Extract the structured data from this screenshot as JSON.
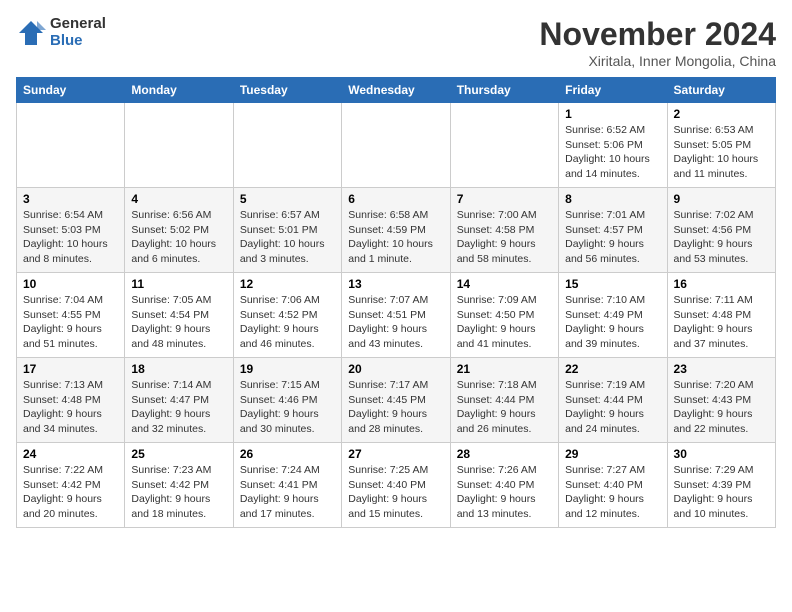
{
  "header": {
    "logo_general": "General",
    "logo_blue": "Blue",
    "month_title": "November 2024",
    "location": "Xiritala, Inner Mongolia, China"
  },
  "columns": [
    "Sunday",
    "Monday",
    "Tuesday",
    "Wednesday",
    "Thursday",
    "Friday",
    "Saturday"
  ],
  "weeks": [
    [
      {
        "day": "",
        "info": ""
      },
      {
        "day": "",
        "info": ""
      },
      {
        "day": "",
        "info": ""
      },
      {
        "day": "",
        "info": ""
      },
      {
        "day": "",
        "info": ""
      },
      {
        "day": "1",
        "info": "Sunrise: 6:52 AM\nSunset: 5:06 PM\nDaylight: 10 hours and 14 minutes."
      },
      {
        "day": "2",
        "info": "Sunrise: 6:53 AM\nSunset: 5:05 PM\nDaylight: 10 hours and 11 minutes."
      }
    ],
    [
      {
        "day": "3",
        "info": "Sunrise: 6:54 AM\nSunset: 5:03 PM\nDaylight: 10 hours and 8 minutes."
      },
      {
        "day": "4",
        "info": "Sunrise: 6:56 AM\nSunset: 5:02 PM\nDaylight: 10 hours and 6 minutes."
      },
      {
        "day": "5",
        "info": "Sunrise: 6:57 AM\nSunset: 5:01 PM\nDaylight: 10 hours and 3 minutes."
      },
      {
        "day": "6",
        "info": "Sunrise: 6:58 AM\nSunset: 4:59 PM\nDaylight: 10 hours and 1 minute."
      },
      {
        "day": "7",
        "info": "Sunrise: 7:00 AM\nSunset: 4:58 PM\nDaylight: 9 hours and 58 minutes."
      },
      {
        "day": "8",
        "info": "Sunrise: 7:01 AM\nSunset: 4:57 PM\nDaylight: 9 hours and 56 minutes."
      },
      {
        "day": "9",
        "info": "Sunrise: 7:02 AM\nSunset: 4:56 PM\nDaylight: 9 hours and 53 minutes."
      }
    ],
    [
      {
        "day": "10",
        "info": "Sunrise: 7:04 AM\nSunset: 4:55 PM\nDaylight: 9 hours and 51 minutes."
      },
      {
        "day": "11",
        "info": "Sunrise: 7:05 AM\nSunset: 4:54 PM\nDaylight: 9 hours and 48 minutes."
      },
      {
        "day": "12",
        "info": "Sunrise: 7:06 AM\nSunset: 4:52 PM\nDaylight: 9 hours and 46 minutes."
      },
      {
        "day": "13",
        "info": "Sunrise: 7:07 AM\nSunset: 4:51 PM\nDaylight: 9 hours and 43 minutes."
      },
      {
        "day": "14",
        "info": "Sunrise: 7:09 AM\nSunset: 4:50 PM\nDaylight: 9 hours and 41 minutes."
      },
      {
        "day": "15",
        "info": "Sunrise: 7:10 AM\nSunset: 4:49 PM\nDaylight: 9 hours and 39 minutes."
      },
      {
        "day": "16",
        "info": "Sunrise: 7:11 AM\nSunset: 4:48 PM\nDaylight: 9 hours and 37 minutes."
      }
    ],
    [
      {
        "day": "17",
        "info": "Sunrise: 7:13 AM\nSunset: 4:48 PM\nDaylight: 9 hours and 34 minutes."
      },
      {
        "day": "18",
        "info": "Sunrise: 7:14 AM\nSunset: 4:47 PM\nDaylight: 9 hours and 32 minutes."
      },
      {
        "day": "19",
        "info": "Sunrise: 7:15 AM\nSunset: 4:46 PM\nDaylight: 9 hours and 30 minutes."
      },
      {
        "day": "20",
        "info": "Sunrise: 7:17 AM\nSunset: 4:45 PM\nDaylight: 9 hours and 28 minutes."
      },
      {
        "day": "21",
        "info": "Sunrise: 7:18 AM\nSunset: 4:44 PM\nDaylight: 9 hours and 26 minutes."
      },
      {
        "day": "22",
        "info": "Sunrise: 7:19 AM\nSunset: 4:44 PM\nDaylight: 9 hours and 24 minutes."
      },
      {
        "day": "23",
        "info": "Sunrise: 7:20 AM\nSunset: 4:43 PM\nDaylight: 9 hours and 22 minutes."
      }
    ],
    [
      {
        "day": "24",
        "info": "Sunrise: 7:22 AM\nSunset: 4:42 PM\nDaylight: 9 hours and 20 minutes."
      },
      {
        "day": "25",
        "info": "Sunrise: 7:23 AM\nSunset: 4:42 PM\nDaylight: 9 hours and 18 minutes."
      },
      {
        "day": "26",
        "info": "Sunrise: 7:24 AM\nSunset: 4:41 PM\nDaylight: 9 hours and 17 minutes."
      },
      {
        "day": "27",
        "info": "Sunrise: 7:25 AM\nSunset: 4:40 PM\nDaylight: 9 hours and 15 minutes."
      },
      {
        "day": "28",
        "info": "Sunrise: 7:26 AM\nSunset: 4:40 PM\nDaylight: 9 hours and 13 minutes."
      },
      {
        "day": "29",
        "info": "Sunrise: 7:27 AM\nSunset: 4:40 PM\nDaylight: 9 hours and 12 minutes."
      },
      {
        "day": "30",
        "info": "Sunrise: 7:29 AM\nSunset: 4:39 PM\nDaylight: 9 hours and 10 minutes."
      }
    ]
  ]
}
